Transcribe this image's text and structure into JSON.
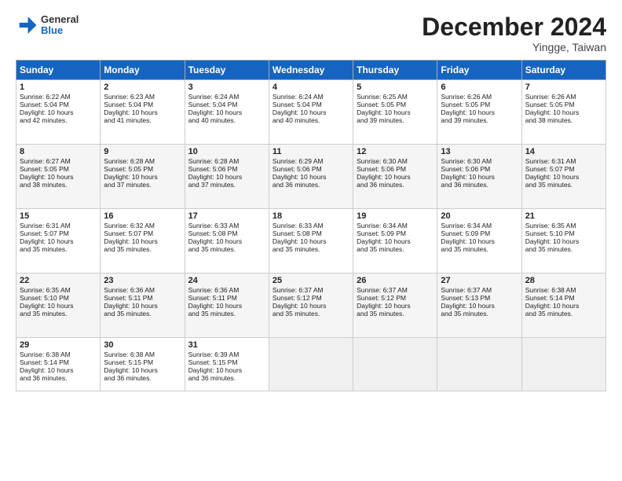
{
  "logo": {
    "general": "General",
    "blue": "Blue"
  },
  "header": {
    "month": "December 2024",
    "location": "Yingge, Taiwan"
  },
  "weekdays": [
    "Sunday",
    "Monday",
    "Tuesday",
    "Wednesday",
    "Thursday",
    "Friday",
    "Saturday"
  ],
  "weeks": [
    [
      {
        "day": "1",
        "lines": [
          "Sunrise: 6:22 AM",
          "Sunset: 5:04 PM",
          "Daylight: 10 hours",
          "and 42 minutes."
        ]
      },
      {
        "day": "2",
        "lines": [
          "Sunrise: 6:23 AM",
          "Sunset: 5:04 PM",
          "Daylight: 10 hours",
          "and 41 minutes."
        ]
      },
      {
        "day": "3",
        "lines": [
          "Sunrise: 6:24 AM",
          "Sunset: 5:04 PM",
          "Daylight: 10 hours",
          "and 40 minutes."
        ]
      },
      {
        "day": "4",
        "lines": [
          "Sunrise: 6:24 AM",
          "Sunset: 5:04 PM",
          "Daylight: 10 hours",
          "and 40 minutes."
        ]
      },
      {
        "day": "5",
        "lines": [
          "Sunrise: 6:25 AM",
          "Sunset: 5:05 PM",
          "Daylight: 10 hours",
          "and 39 minutes."
        ]
      },
      {
        "day": "6",
        "lines": [
          "Sunrise: 6:26 AM",
          "Sunset: 5:05 PM",
          "Daylight: 10 hours",
          "and 39 minutes."
        ]
      },
      {
        "day": "7",
        "lines": [
          "Sunrise: 6:26 AM",
          "Sunset: 5:05 PM",
          "Daylight: 10 hours",
          "and 38 minutes."
        ]
      }
    ],
    [
      {
        "day": "8",
        "lines": [
          "Sunrise: 6:27 AM",
          "Sunset: 5:05 PM",
          "Daylight: 10 hours",
          "and 38 minutes."
        ]
      },
      {
        "day": "9",
        "lines": [
          "Sunrise: 6:28 AM",
          "Sunset: 5:05 PM",
          "Daylight: 10 hours",
          "and 37 minutes."
        ]
      },
      {
        "day": "10",
        "lines": [
          "Sunrise: 6:28 AM",
          "Sunset: 5:06 PM",
          "Daylight: 10 hours",
          "and 37 minutes."
        ]
      },
      {
        "day": "11",
        "lines": [
          "Sunrise: 6:29 AM",
          "Sunset: 5:06 PM",
          "Daylight: 10 hours",
          "and 36 minutes."
        ]
      },
      {
        "day": "12",
        "lines": [
          "Sunrise: 6:30 AM",
          "Sunset: 5:06 PM",
          "Daylight: 10 hours",
          "and 36 minutes."
        ]
      },
      {
        "day": "13",
        "lines": [
          "Sunrise: 6:30 AM",
          "Sunset: 5:06 PM",
          "Daylight: 10 hours",
          "and 36 minutes."
        ]
      },
      {
        "day": "14",
        "lines": [
          "Sunrise: 6:31 AM",
          "Sunset: 5:07 PM",
          "Daylight: 10 hours",
          "and 35 minutes."
        ]
      }
    ],
    [
      {
        "day": "15",
        "lines": [
          "Sunrise: 6:31 AM",
          "Sunset: 5:07 PM",
          "Daylight: 10 hours",
          "and 35 minutes."
        ]
      },
      {
        "day": "16",
        "lines": [
          "Sunrise: 6:32 AM",
          "Sunset: 5:07 PM",
          "Daylight: 10 hours",
          "and 35 minutes."
        ]
      },
      {
        "day": "17",
        "lines": [
          "Sunrise: 6:33 AM",
          "Sunset: 5:08 PM",
          "Daylight: 10 hours",
          "and 35 minutes."
        ]
      },
      {
        "day": "18",
        "lines": [
          "Sunrise: 6:33 AM",
          "Sunset: 5:08 PM",
          "Daylight: 10 hours",
          "and 35 minutes."
        ]
      },
      {
        "day": "19",
        "lines": [
          "Sunrise: 6:34 AM",
          "Sunset: 5:09 PM",
          "Daylight: 10 hours",
          "and 35 minutes."
        ]
      },
      {
        "day": "20",
        "lines": [
          "Sunrise: 6:34 AM",
          "Sunset: 5:09 PM",
          "Daylight: 10 hours",
          "and 35 minutes."
        ]
      },
      {
        "day": "21",
        "lines": [
          "Sunrise: 6:35 AM",
          "Sunset: 5:10 PM",
          "Daylight: 10 hours",
          "and 35 minutes."
        ]
      }
    ],
    [
      {
        "day": "22",
        "lines": [
          "Sunrise: 6:35 AM",
          "Sunset: 5:10 PM",
          "Daylight: 10 hours",
          "and 35 minutes."
        ]
      },
      {
        "day": "23",
        "lines": [
          "Sunrise: 6:36 AM",
          "Sunset: 5:11 PM",
          "Daylight: 10 hours",
          "and 35 minutes."
        ]
      },
      {
        "day": "24",
        "lines": [
          "Sunrise: 6:36 AM",
          "Sunset: 5:11 PM",
          "Daylight: 10 hours",
          "and 35 minutes."
        ]
      },
      {
        "day": "25",
        "lines": [
          "Sunrise: 6:37 AM",
          "Sunset: 5:12 PM",
          "Daylight: 10 hours",
          "and 35 minutes."
        ]
      },
      {
        "day": "26",
        "lines": [
          "Sunrise: 6:37 AM",
          "Sunset: 5:12 PM",
          "Daylight: 10 hours",
          "and 35 minutes."
        ]
      },
      {
        "day": "27",
        "lines": [
          "Sunrise: 6:37 AM",
          "Sunset: 5:13 PM",
          "Daylight: 10 hours",
          "and 35 minutes."
        ]
      },
      {
        "day": "28",
        "lines": [
          "Sunrise: 6:38 AM",
          "Sunset: 5:14 PM",
          "Daylight: 10 hours",
          "and 35 minutes."
        ]
      }
    ],
    [
      {
        "day": "29",
        "lines": [
          "Sunrise: 6:38 AM",
          "Sunset: 5:14 PM",
          "Daylight: 10 hours",
          "and 36 minutes."
        ]
      },
      {
        "day": "30",
        "lines": [
          "Sunrise: 6:38 AM",
          "Sunset: 5:15 PM",
          "Daylight: 10 hours",
          "and 36 minutes."
        ]
      },
      {
        "day": "31",
        "lines": [
          "Sunrise: 6:39 AM",
          "Sunset: 5:15 PM",
          "Daylight: 10 hours",
          "and 36 minutes."
        ]
      },
      null,
      null,
      null,
      null
    ]
  ]
}
